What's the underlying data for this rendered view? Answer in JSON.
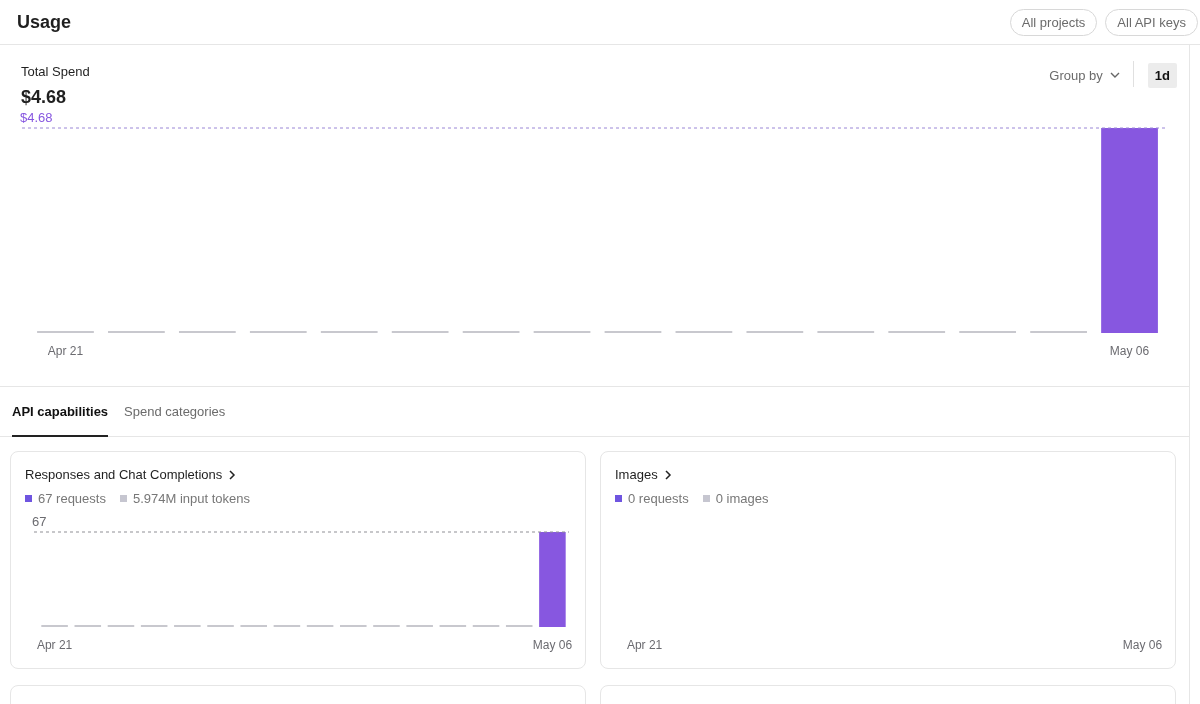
{
  "page": {
    "title": "Usage",
    "filters": [
      {
        "label": "All projects"
      },
      {
        "label": "All API keys"
      }
    ]
  },
  "spend": {
    "title": "Total Spend",
    "total": "$4.68",
    "group_by": "Group by",
    "intervals": [
      {
        "label": "1d",
        "selected": true
      }
    ],
    "chart": {
      "peak_label": "$4.68",
      "axis_labels": [
        "Apr 21",
        "May 06"
      ]
    }
  },
  "tabs": [
    {
      "label": "API capabilities",
      "selected": true
    },
    {
      "label": "Spend categories",
      "selected": false
    }
  ],
  "cards": [
    {
      "kind": "chart",
      "title": "Responses and Chat Completions",
      "legend": [
        {
          "label": "67 requests",
          "color": "#6f55e0"
        },
        {
          "label": "5.974M input tokens",
          "color": "#c6c6d0"
        }
      ],
      "chart": {
        "peak_label": "67",
        "axis_labels": [
          "Apr 21",
          "May 06"
        ]
      }
    },
    {
      "kind": "empty_chart",
      "title": "Images",
      "legend": [
        {
          "label": "0 requests",
          "color": "#6f55e0"
        },
        {
          "label": "0 images",
          "color": "#c6c6d0"
        }
      ],
      "chart": {
        "axis_labels": [
          "Apr 21",
          "May 06"
        ]
      }
    },
    {
      "kind": "clipped"
    },
    {
      "kind": "clipped"
    }
  ]
}
